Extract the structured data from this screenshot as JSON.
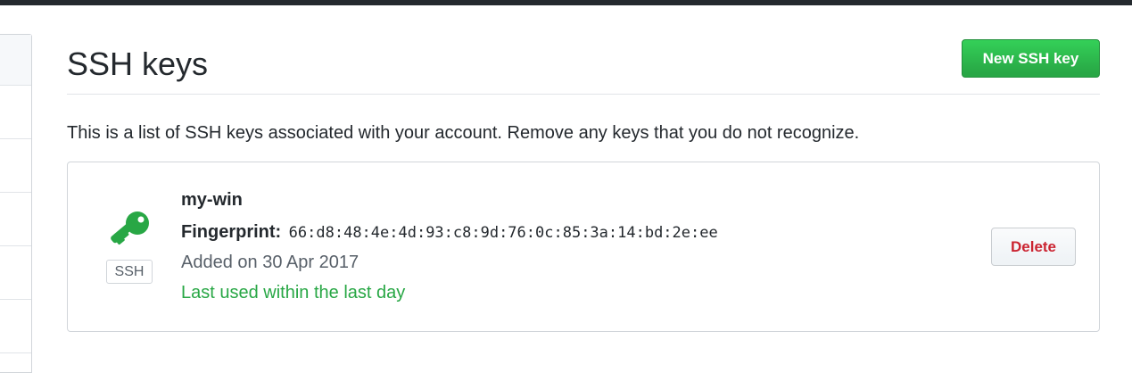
{
  "header": {
    "title": "SSH keys",
    "new_key_label": "New SSH key"
  },
  "description": "This is a list of SSH keys associated with your account. Remove any keys that you do not recognize.",
  "keys": [
    {
      "title": "my-win",
      "badge": "SSH",
      "icon": "key-icon",
      "fingerprint_label": "Fingerprint:",
      "fingerprint": "66:d8:48:4e:4d:93:c8:9d:76:0c:85:3a:14:bd:2e:ee",
      "added": "Added on 30 Apr 2017",
      "last_used": "Last used within the last day",
      "delete_label": "Delete"
    }
  ],
  "colors": {
    "accent_green": "#28a745",
    "danger_red": "#cb2431",
    "top_bar": "#24292e"
  }
}
